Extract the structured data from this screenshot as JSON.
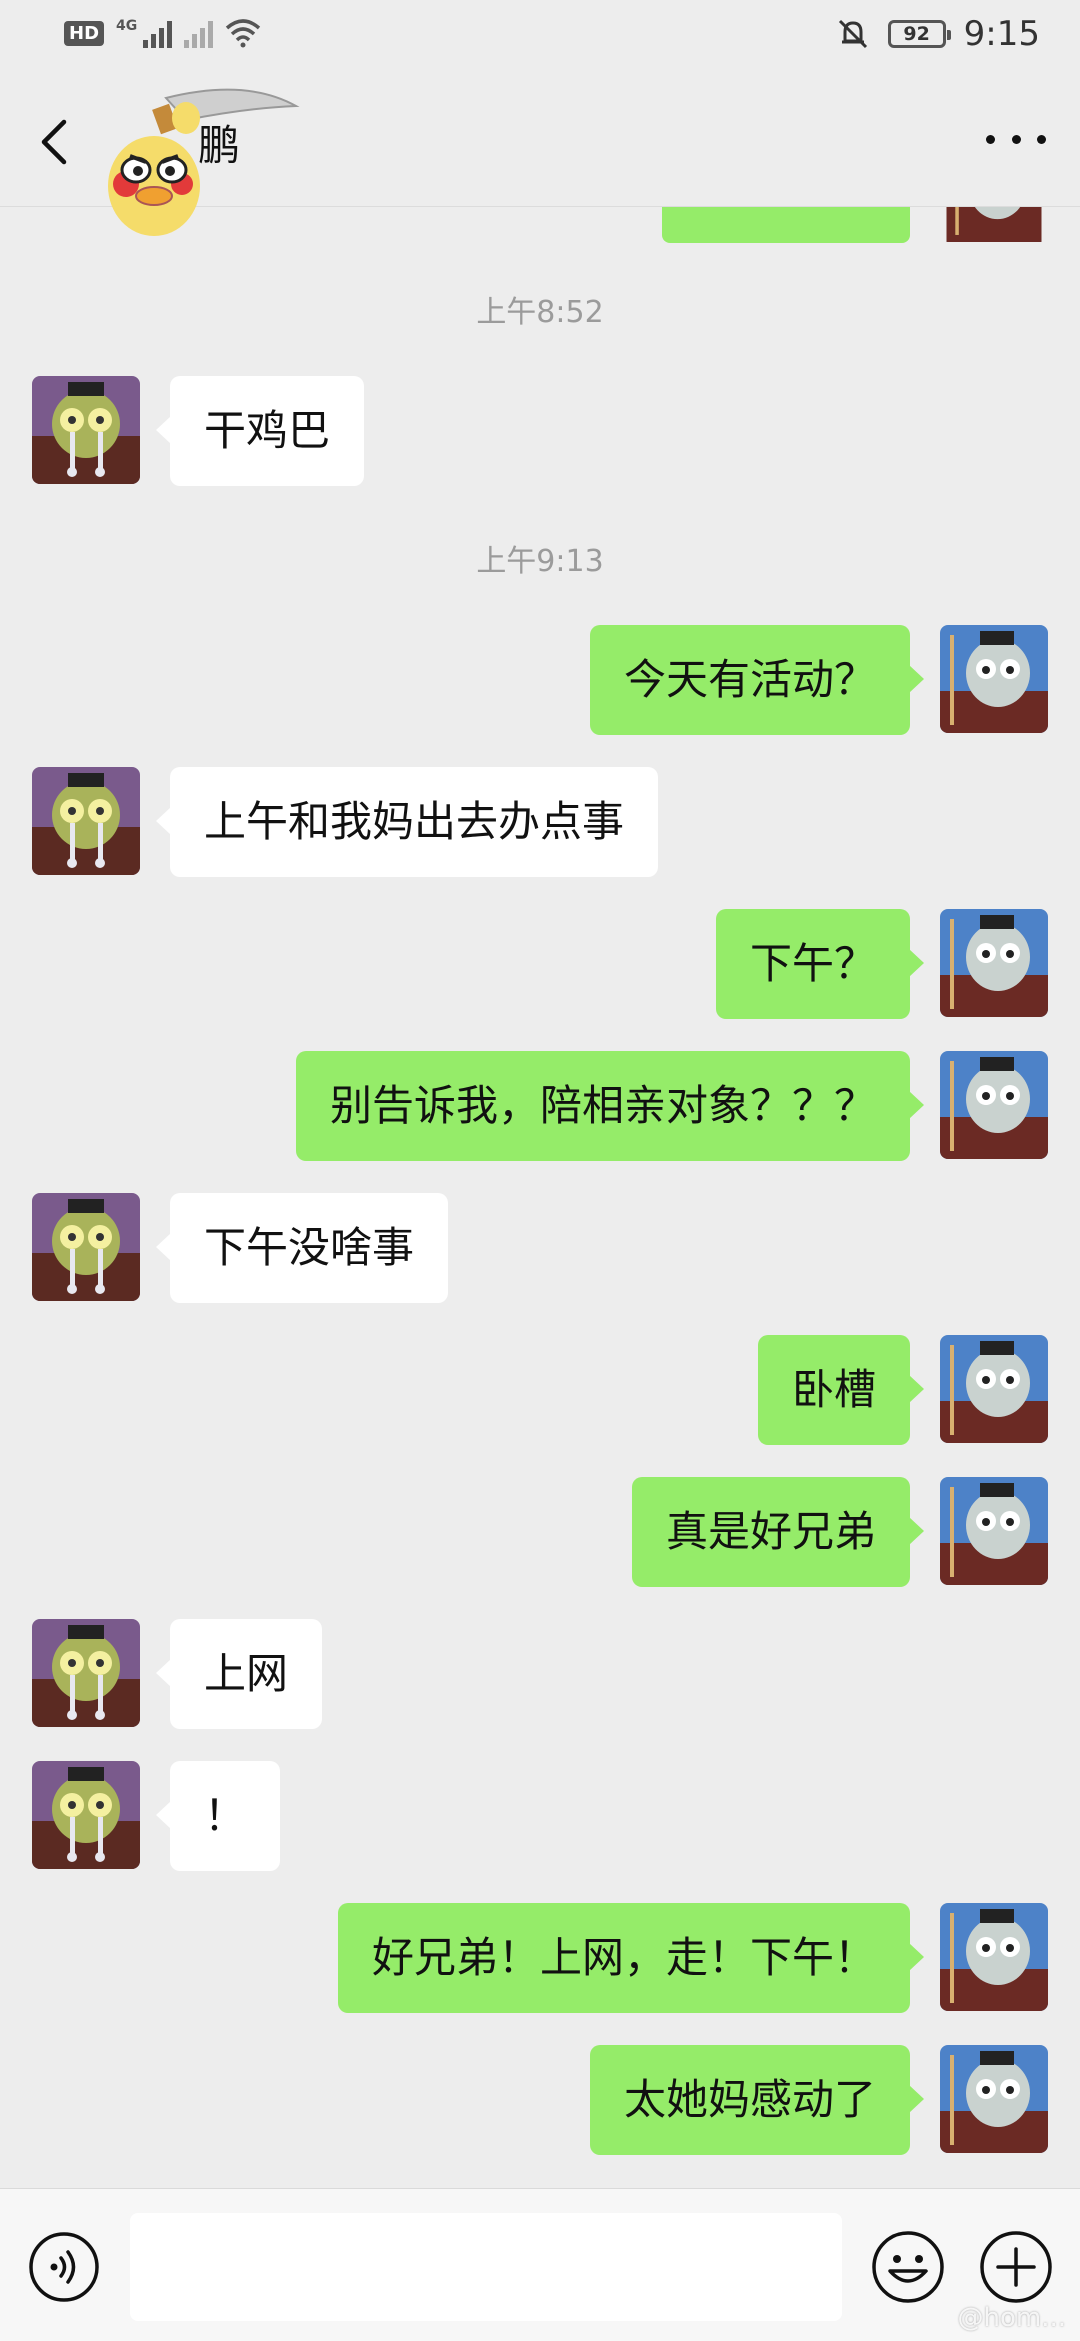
{
  "status_bar": {
    "hd_label": "HD",
    "network_label": "4G",
    "battery_level": "92",
    "time": "9:15"
  },
  "header": {
    "title": "鹏"
  },
  "timestamps": [
    "上午8:52",
    "上午9:13"
  ],
  "messages": [
    {
      "side": "in",
      "text": "干鸡巴"
    },
    {
      "side": "out",
      "text": "今天有活动？"
    },
    {
      "side": "in",
      "text": "上午和我妈出去办点事"
    },
    {
      "side": "out",
      "text": "下午？"
    },
    {
      "side": "out",
      "text": "别告诉我，陪相亲对象？？？"
    },
    {
      "side": "in",
      "text": "下午没啥事"
    },
    {
      "side": "out",
      "text": "卧槽"
    },
    {
      "side": "out",
      "text": "真是好兄弟"
    },
    {
      "side": "in",
      "text": "上网"
    },
    {
      "side": "in",
      "text": "！"
    },
    {
      "side": "out",
      "text": "好兄弟！上网，走！下午！"
    },
    {
      "side": "out",
      "text": "太她妈感动了"
    }
  ],
  "input": {
    "value": ""
  },
  "colors": {
    "background": "#ededed",
    "outgoing_bubble": "#95ec69",
    "incoming_bubble": "#ffffff",
    "timestamp": "#9b9b9b"
  },
  "icons": {
    "back": "chevron-left-icon",
    "more": "more-dots-icon",
    "voice": "voice-icon",
    "emoji": "emoji-icon",
    "plus": "plus-icon"
  },
  "watermark": "@hom..."
}
